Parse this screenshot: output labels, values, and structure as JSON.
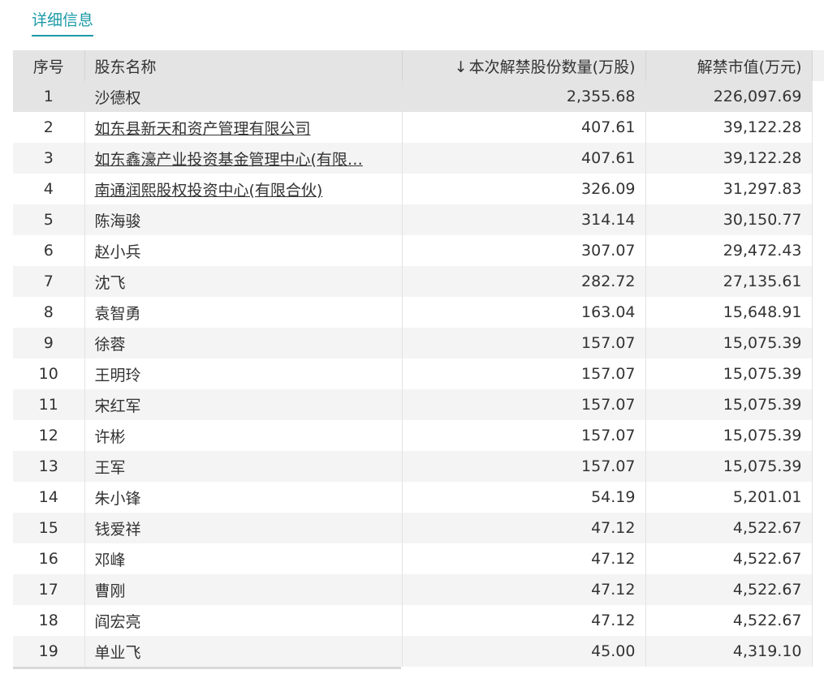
{
  "tab": {
    "label": "详细信息"
  },
  "table": {
    "headers": {
      "index": "序号",
      "name": "股东名称",
      "sort_arrow": "↓",
      "quantity": "本次解禁股份数量(万股)",
      "value": "解禁市值(万元)"
    },
    "rows": [
      {
        "index": "1",
        "name": "沙德权",
        "quantity": "2,355.68",
        "value": "226,097.69",
        "link": false,
        "selected": true
      },
      {
        "index": "2",
        "name": "如东县新天和资产管理有限公司",
        "quantity": "407.61",
        "value": "39,122.28",
        "link": true,
        "selected": false
      },
      {
        "index": "3",
        "name": "如东鑫濠产业投资基金管理中心(有限…",
        "quantity": "407.61",
        "value": "39,122.28",
        "link": true,
        "selected": false
      },
      {
        "index": "4",
        "name": "南通润熙股权投资中心(有限合伙)",
        "quantity": "326.09",
        "value": "31,297.83",
        "link": true,
        "selected": false
      },
      {
        "index": "5",
        "name": "陈海骏",
        "quantity": "314.14",
        "value": "30,150.77",
        "link": false,
        "selected": false
      },
      {
        "index": "6",
        "name": "赵小兵",
        "quantity": "307.07",
        "value": "29,472.43",
        "link": false,
        "selected": false
      },
      {
        "index": "7",
        "name": "沈飞",
        "quantity": "282.72",
        "value": "27,135.61",
        "link": false,
        "selected": false
      },
      {
        "index": "8",
        "name": "袁智勇",
        "quantity": "163.04",
        "value": "15,648.91",
        "link": false,
        "selected": false
      },
      {
        "index": "9",
        "name": "徐蓉",
        "quantity": "157.07",
        "value": "15,075.39",
        "link": false,
        "selected": false
      },
      {
        "index": "10",
        "name": "王明玲",
        "quantity": "157.07",
        "value": "15,075.39",
        "link": false,
        "selected": false
      },
      {
        "index": "11",
        "name": "宋红军",
        "quantity": "157.07",
        "value": "15,075.39",
        "link": false,
        "selected": false
      },
      {
        "index": "12",
        "name": "许彬",
        "quantity": "157.07",
        "value": "15,075.39",
        "link": false,
        "selected": false
      },
      {
        "index": "13",
        "name": "王军",
        "quantity": "157.07",
        "value": "15,075.39",
        "link": false,
        "selected": false
      },
      {
        "index": "14",
        "name": "朱小锋",
        "quantity": "54.19",
        "value": "5,201.01",
        "link": false,
        "selected": false
      },
      {
        "index": "15",
        "name": "钱爱祥",
        "quantity": "47.12",
        "value": "4,522.67",
        "link": false,
        "selected": false
      },
      {
        "index": "16",
        "name": "邓峰",
        "quantity": "47.12",
        "value": "4,522.67",
        "link": false,
        "selected": false
      },
      {
        "index": "17",
        "name": "曹刚",
        "quantity": "47.12",
        "value": "4,522.67",
        "link": false,
        "selected": false
      },
      {
        "index": "18",
        "name": "阎宏亮",
        "quantity": "47.12",
        "value": "4,522.67",
        "link": false,
        "selected": false
      },
      {
        "index": "19",
        "name": "单业飞",
        "quantity": "45.00",
        "value": "4,319.10",
        "link": false,
        "selected": false
      }
    ]
  },
  "colors": {
    "accent": "#1a9aa6",
    "header_bg": "#e4e4e4",
    "stripe_bg": "#f4f4f4"
  }
}
